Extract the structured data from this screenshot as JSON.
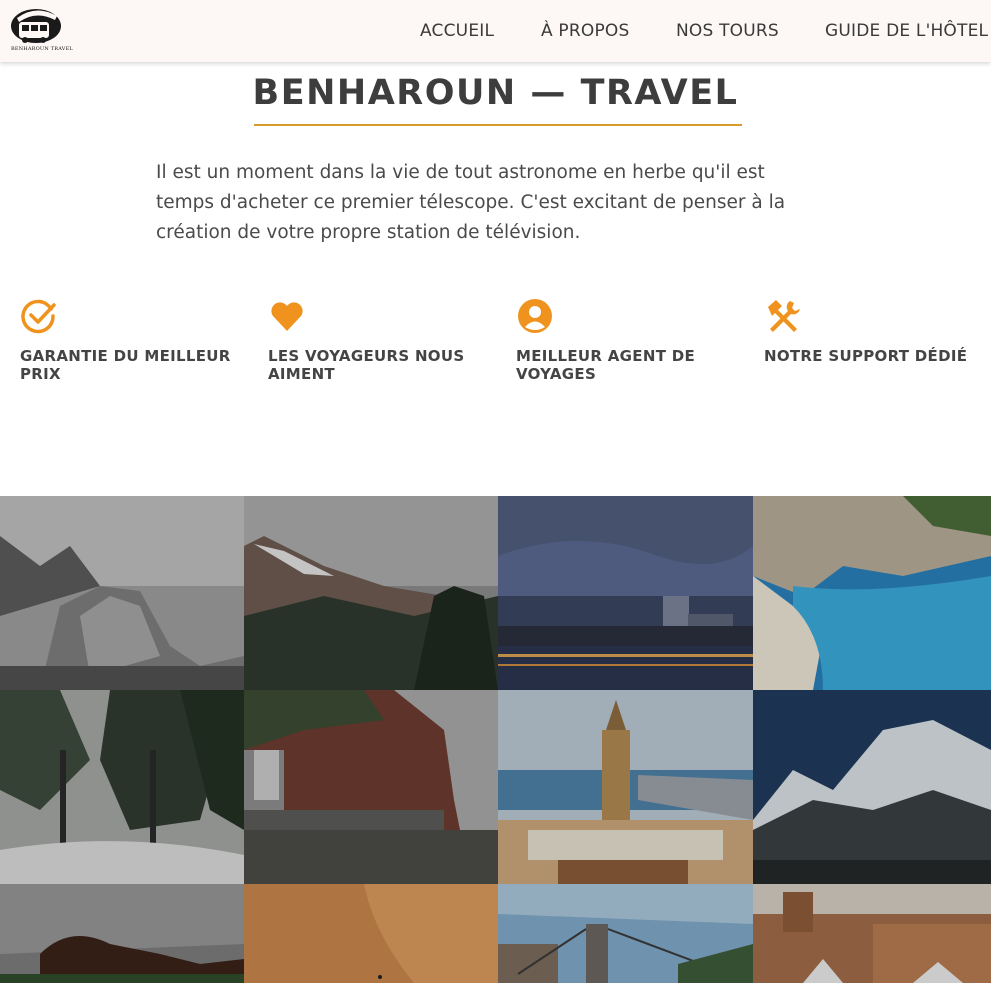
{
  "header": {
    "logo_text": "BENHAROUN TRAVEL",
    "nav": [
      "ACCUEIL",
      "À PROPOS",
      "NOS TOURS",
      "GUIDE DE L'HÔTEL"
    ]
  },
  "main": {
    "title": "BENHAROUN — TRAVEL",
    "intro": "Il est un moment dans la vie de tout astronome en herbe qu'il est temps d'acheter ce premier télescope. C'est excitant de penser à la création de votre propre station de télévision.",
    "features": [
      {
        "label": "GARANTIE DU MEILLEUR PRIX",
        "icon": "check-circle-icon"
      },
      {
        "label": "LES VOYAGEURS NOUS AIMENT",
        "icon": "heart-icon"
      },
      {
        "label": "MEILLEUR AGENT DE VOYAGES",
        "icon": "user-circle-icon"
      },
      {
        "label": "NOTRE SUPPORT DÉDIÉ",
        "icon": "tools-icon"
      }
    ]
  },
  "colors": {
    "accent": "#f0931e",
    "underline": "#d79a2b",
    "text": "#3d3d3d"
  }
}
